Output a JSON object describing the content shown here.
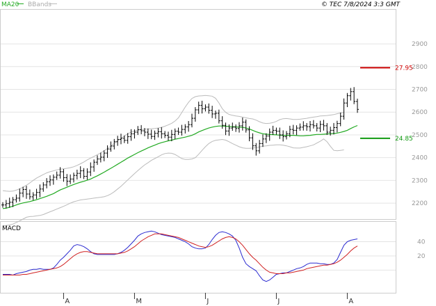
{
  "header": {
    "legend_ma": "MA20",
    "legend_bbands": "BBands",
    "copyright": "© TEC 7/8/2024 3:3 GMT"
  },
  "macd_panel": {
    "label": "MACD"
  },
  "colors": {
    "price": "#000000",
    "ma20": "#22aa22",
    "bbands": "#bbbbbb",
    "macd_line": "#2a2ad0",
    "signal_line": "#d02020",
    "resistance": "#cc0000",
    "support": "#119911",
    "grid": "#e4e4e4"
  },
  "chart_data": [
    {
      "type": "candlestick",
      "title": "",
      "y_ticks": [
        "2900",
        "2800",
        "2700",
        "2600",
        "2500",
        "2400",
        "2300",
        "2200"
      ],
      "ylim": [
        2130,
        3050
      ],
      "x_labels": [
        "A",
        "M",
        "J",
        "J",
        "A"
      ],
      "grid": true,
      "levels": [
        {
          "name": "resistance",
          "value": 27.95,
          "label": "27.95"
        },
        {
          "name": "support",
          "value": 24.85,
          "label": "24.85"
        }
      ],
      "closes": [
        2192,
        2198,
        2204,
        2215,
        2222,
        2244,
        2260,
        2240,
        2228,
        2236,
        2247,
        2262,
        2280,
        2294,
        2302,
        2314,
        2323,
        2338,
        2312,
        2296,
        2306,
        2322,
        2331,
        2342,
        2318,
        2337,
        2359,
        2380,
        2394,
        2402,
        2420,
        2438,
        2451,
        2470,
        2480,
        2485,
        2476,
        2492,
        2505,
        2512,
        2523,
        2518,
        2512,
        2503,
        2493,
        2507,
        2514,
        2505,
        2498,
        2490,
        2502,
        2516,
        2512,
        2524,
        2535,
        2545,
        2573,
        2610,
        2630,
        2615,
        2622,
        2608,
        2592,
        2595,
        2562,
        2542,
        2517,
        2530,
        2534,
        2528,
        2540,
        2556,
        2522,
        2487,
        2452,
        2430,
        2462,
        2482,
        2495,
        2512,
        2520,
        2516,
        2500,
        2492,
        2505,
        2524,
        2520,
        2530,
        2534,
        2540,
        2536,
        2545,
        2540,
        2530,
        2546,
        2540,
        2512,
        2520,
        2532,
        2550,
        2582,
        2640,
        2672,
        2690,
        2647,
        2612
      ],
      "ma20": [
        2176,
        2178,
        2182,
        2187,
        2192,
        2197,
        2201,
        2204,
        2207,
        2211,
        2215,
        2220,
        2225,
        2230,
        2236,
        2242,
        2250,
        2258,
        2264,
        2270,
        2276,
        2282,
        2287,
        2292,
        2296,
        2301,
        2306,
        2313,
        2320,
        2328,
        2336,
        2345,
        2353,
        2362,
        2371,
        2380,
        2389,
        2398,
        2406,
        2414,
        2422,
        2429,
        2436,
        2443,
        2449,
        2455,
        2461,
        2466,
        2470,
        2474,
        2477,
        2481,
        2484,
        2487,
        2490,
        2494,
        2498,
        2505,
        2513,
        2519,
        2525,
        2530,
        2534,
        2537,
        2539,
        2539,
        2538,
        2537,
        2536,
        2535,
        2534,
        2533,
        2530,
        2526,
        2520,
        2514,
        2509,
        2505,
        2503,
        2502,
        2501,
        2500,
        2499,
        2498,
        2498,
        2498,
        2498,
        2497,
        2496,
        2496,
        2497,
        2498,
        2500,
        2502,
        2502,
        2503,
        2504,
        2505,
        2506,
        2508,
        2511,
        2515,
        2520,
        2528,
        2535,
        2541
      ],
      "bb_upper": [
        2255,
        2253,
        2252,
        2253,
        2257,
        2263,
        2270,
        2279,
        2289,
        2300,
        2310,
        2318,
        2326,
        2333,
        2338,
        2342,
        2346,
        2349,
        2351,
        2353,
        2356,
        2360,
        2366,
        2373,
        2381,
        2390,
        2398,
        2405,
        2413,
        2421,
        2430,
        2440,
        2451,
        2462,
        2473,
        2485,
        2495,
        2505,
        2512,
        2517,
        2521,
        2523,
        2525,
        2526,
        2527,
        2528,
        2530,
        2533,
        2538,
        2544,
        2551,
        2561,
        2575,
        2598,
        2622,
        2643,
        2660,
        2668,
        2671,
        2672,
        2673,
        2672,
        2670,
        2661,
        2640,
        2615,
        2599,
        2590,
        2586,
        2583,
        2581,
        2578,
        2575,
        2572,
        2570,
        2565,
        2558,
        2552,
        2550,
        2551,
        2554,
        2559,
        2567,
        2571,
        2572,
        2570,
        2568,
        2568,
        2569,
        2571,
        2573,
        2576,
        2578,
        2580,
        2583,
        2584,
        2585,
        2587,
        2589,
        2593,
        2596,
        2598
      ],
      "bb_lower": [
        2100,
        2102,
        2104,
        2108,
        2115,
        2122,
        2130,
        2138,
        2141,
        2142,
        2144,
        2146,
        2150,
        2156,
        2162,
        2168,
        2174,
        2180,
        2186,
        2193,
        2200,
        2206,
        2210,
        2214,
        2216,
        2218,
        2220,
        2222,
        2224,
        2226,
        2228,
        2233,
        2240,
        2250,
        2262,
        2274,
        2288,
        2302,
        2316,
        2330,
        2343,
        2356,
        2368,
        2378,
        2388,
        2396,
        2404,
        2412,
        2418,
        2420,
        2419,
        2414,
        2405,
        2396,
        2392,
        2392,
        2394,
        2400,
        2415,
        2432,
        2448,
        2462,
        2471,
        2476,
        2478,
        2480,
        2477,
        2470,
        2462,
        2455,
        2448,
        2443,
        2441,
        2441,
        2442,
        2444,
        2447,
        2450,
        2452,
        2454,
        2455,
        2456,
        2456,
        2455,
        2452,
        2448,
        2443,
        2442,
        2442,
        2445,
        2448,
        2452,
        2456,
        2464,
        2472,
        2482,
        2470,
        2450,
        2432,
        2430,
        2432,
        2434
      ]
    },
    {
      "type": "line",
      "title": "MACD",
      "y_ticks": [
        "40",
        "20"
      ],
      "ylim": [
        -32,
        68
      ],
      "series": [
        {
          "name": "",
          "values": [
            -6,
            -6,
            -6,
            -7,
            -5,
            -4,
            -3,
            -2,
            0,
            1,
            1,
            2,
            1,
            1,
            1,
            3,
            8,
            14,
            18,
            23,
            28,
            34,
            36,
            35,
            33,
            30,
            26,
            23,
            22,
            22,
            22,
            22,
            22,
            22,
            23,
            25,
            28,
            32,
            37,
            42,
            48,
            51,
            53,
            54,
            55,
            54,
            52,
            50,
            49,
            48,
            47,
            46,
            44,
            42,
            40,
            37,
            33,
            31,
            30,
            30,
            31,
            36,
            43,
            49,
            53,
            54,
            53,
            51,
            48,
            42,
            31,
            18,
            9,
            5,
            2,
            -1,
            -8,
            -14,
            -16,
            -14,
            -10,
            -6,
            -5,
            -4,
            -4,
            -2,
            0,
            2,
            3,
            5,
            8,
            10,
            10,
            10,
            9,
            9,
            8,
            8,
            10,
            15,
            25,
            35,
            40,
            42,
            43,
            44
          ]
        },
        {
          "name": "",
          "values": [
            -7,
            -7,
            -7,
            -7,
            -7,
            -7,
            -6,
            -6,
            -5,
            -4,
            -3,
            -2,
            -1,
            0,
            1,
            2,
            3,
            5,
            8,
            12,
            16,
            20,
            23,
            25,
            26,
            26,
            25,
            24,
            23,
            23,
            23,
            23,
            23,
            23,
            23,
            24,
            25,
            27,
            30,
            33,
            37,
            41,
            44,
            47,
            49,
            51,
            51,
            51,
            50,
            49,
            48,
            47,
            46,
            44,
            42,
            40,
            38,
            36,
            34,
            33,
            32,
            33,
            35,
            38,
            41,
            44,
            46,
            47,
            46,
            44,
            40,
            35,
            29,
            23,
            18,
            14,
            9,
            4,
            0,
            -3,
            -4,
            -5,
            -5,
            -5,
            -4,
            -4,
            -3,
            -2,
            -1,
            0,
            2,
            3,
            4,
            5,
            6,
            7,
            7,
            8,
            9,
            11,
            14,
            18,
            22,
            27,
            31,
            34
          ]
        }
      ]
    }
  ]
}
